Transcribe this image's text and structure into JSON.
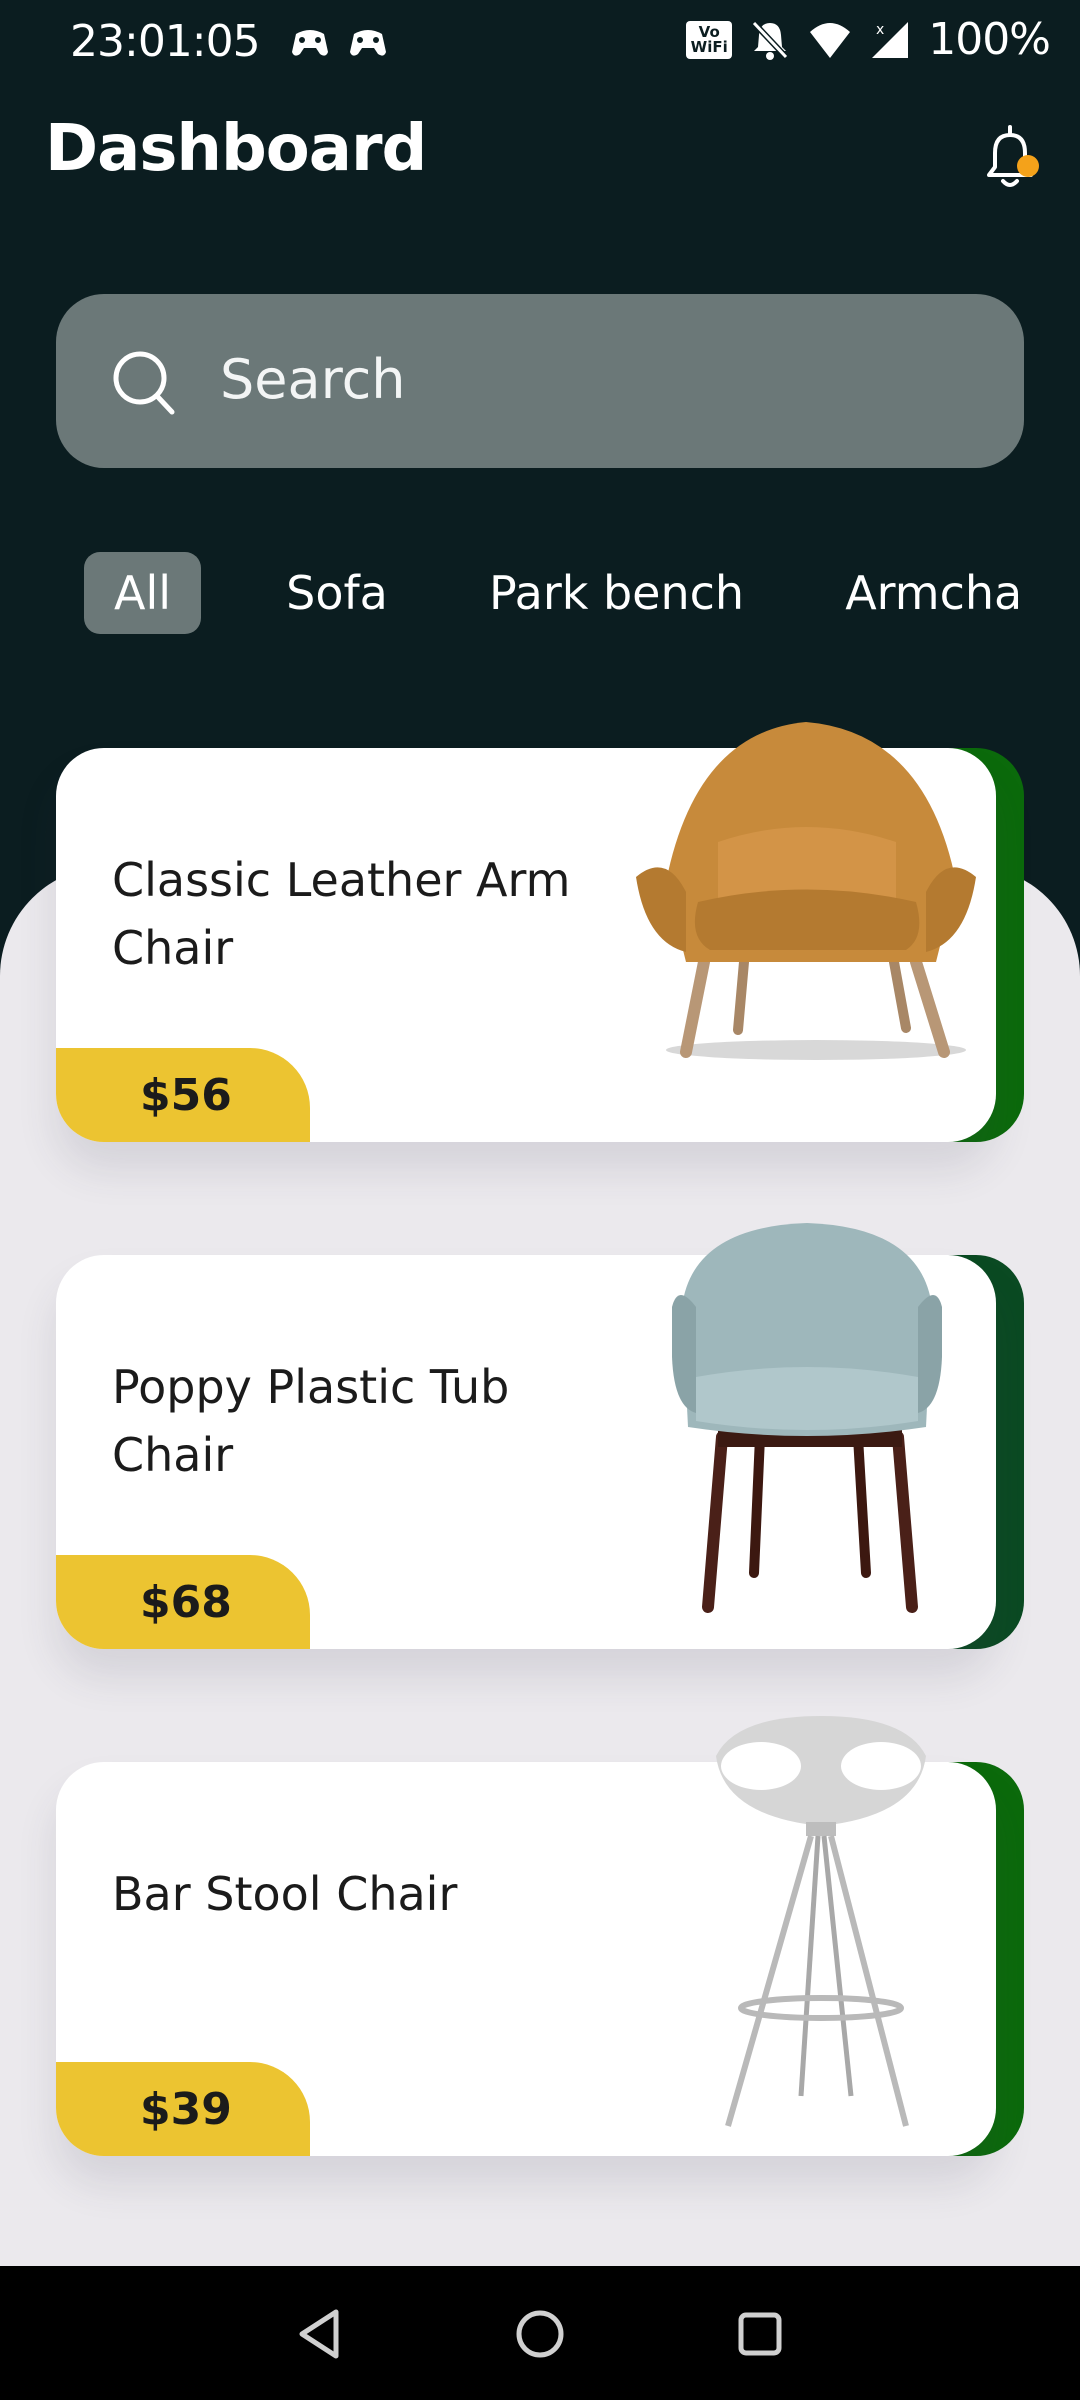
{
  "status_bar": {
    "time": "23:01:05",
    "wifi_badge_top": "Vo",
    "wifi_badge_bottom": "WiFi",
    "battery": "100%"
  },
  "header": {
    "title": "Dashboard",
    "notification_dot_color": "#f4a21a"
  },
  "search": {
    "placeholder": "Search"
  },
  "tabs": [
    {
      "label": "All",
      "active": true
    },
    {
      "label": "Sofa",
      "active": false
    },
    {
      "label": "Park bench",
      "active": false
    },
    {
      "label": "Armchair",
      "active": false
    }
  ],
  "products": [
    {
      "name": "Classic Leather Arm Chair",
      "price": "$56",
      "accent_color": "#0b6a0b",
      "image": "mustard-armchair"
    },
    {
      "name": "Poppy Plastic Tub Chair",
      "price": "$68",
      "accent_color": "#0a4a22",
      "image": "blue-tub-chair"
    },
    {
      "name": "Bar Stool Chair",
      "price": "$39",
      "accent_color": "#0b6a0b",
      "image": "white-bar-stool"
    }
  ],
  "colors": {
    "background_dark": "#0b1d20",
    "content_light": "#ebe9ed",
    "search_bg": "#6b7878",
    "price_tag": "#ecc431"
  },
  "nav": {
    "icons": [
      "back-icon",
      "home-icon",
      "recents-icon"
    ]
  }
}
